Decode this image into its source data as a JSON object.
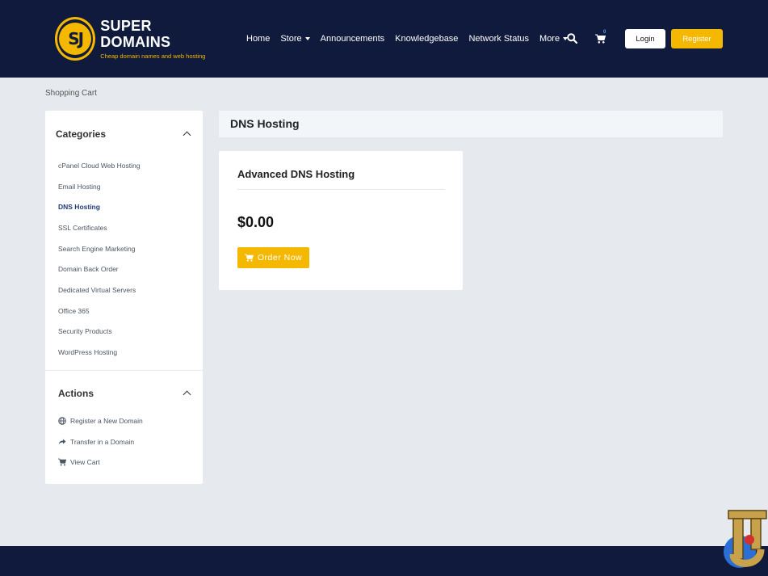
{
  "brand": {
    "logo_letters": "SJ",
    "name": "SUPER DOMAINS",
    "tagline": "Cheap domain names and web hosting"
  },
  "nav": {
    "items": [
      {
        "label": "Home"
      },
      {
        "label": "Store"
      },
      {
        "label": "Announcements"
      },
      {
        "label": "Knowledgebase"
      },
      {
        "label": "Network Status"
      },
      {
        "label": "More"
      }
    ],
    "cart_count": "0",
    "login_label": "Login",
    "register_label": "Register"
  },
  "breadcrumb": "Shopping Cart",
  "sidebar": {
    "categories_title": "Categories",
    "categories": [
      {
        "label": "cPanel Cloud Web Hosting"
      },
      {
        "label": "Email Hosting"
      },
      {
        "label": "DNS Hosting"
      },
      {
        "label": "SSL Certificates"
      },
      {
        "label": "Search Engine Marketing"
      },
      {
        "label": "Domain Back Order"
      },
      {
        "label": "Dedicated Virtual Servers"
      },
      {
        "label": "Office 365"
      },
      {
        "label": "Security Products"
      },
      {
        "label": "WordPress Hosting"
      }
    ],
    "actions_title": "Actions",
    "actions": [
      {
        "label": "Register a New Domain",
        "icon": "globe-icon"
      },
      {
        "label": "Transfer in a Domain",
        "icon": "share-icon"
      },
      {
        "label": "View Cart",
        "icon": "cart-icon"
      }
    ]
  },
  "main": {
    "title": "DNS Hosting",
    "product": {
      "name": "Advanced DNS Hosting",
      "price": "$0.00",
      "order_label": "Order Now"
    }
  },
  "watermark": "TJ",
  "colors": {
    "header_bg": "#0f1a3c",
    "accent": "#f5b800",
    "page_bg": "#e6eaee",
    "active_link": "#1f3a7a"
  }
}
